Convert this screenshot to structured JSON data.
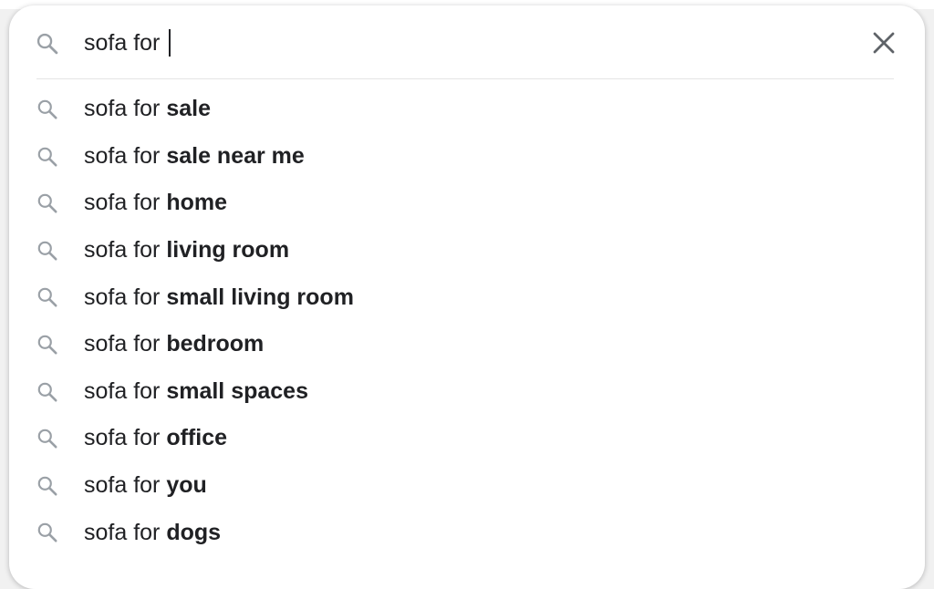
{
  "search": {
    "query": "sofa for ",
    "clear_icon": "close-icon",
    "search_icon": "search-icon"
  },
  "suggestions": [
    {
      "prefix": "sofa for ",
      "completion": "sale"
    },
    {
      "prefix": "sofa for ",
      "completion": "sale near me"
    },
    {
      "prefix": "sofa for ",
      "completion": "home"
    },
    {
      "prefix": "sofa for ",
      "completion": "living room"
    },
    {
      "prefix": "sofa for ",
      "completion": "small living room"
    },
    {
      "prefix": "sofa for ",
      "completion": "bedroom"
    },
    {
      "prefix": "sofa for ",
      "completion": "small spaces"
    },
    {
      "prefix": "sofa for ",
      "completion": "office"
    },
    {
      "prefix": "sofa for ",
      "completion": "you"
    },
    {
      "prefix": "sofa for ",
      "completion": "dogs"
    }
  ],
  "colors": {
    "text": "#202124",
    "icon": "#9aa0a6",
    "clear_icon": "#5f6368",
    "divider": "#e4e4e4",
    "background": "#ffffff"
  }
}
